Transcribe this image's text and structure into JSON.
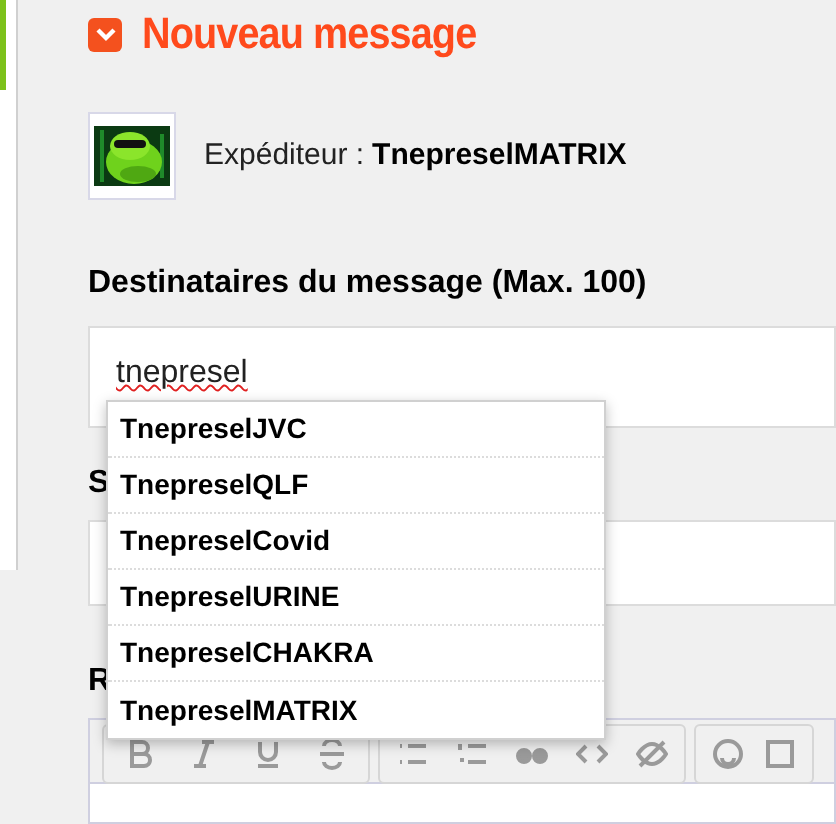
{
  "title": "Nouveau message",
  "sender": {
    "label": "Expéditeur :",
    "name": "TnepreselMATRIX"
  },
  "recipients": {
    "label": "Destinataires du message (Max. 100)",
    "value": "tnepresel"
  },
  "suggestions": [
    {
      "label": "TnepreselJVC"
    },
    {
      "label": "TnepreselQLF"
    },
    {
      "label": "TnepreselCovid"
    },
    {
      "label": "TnepreselURINE"
    },
    {
      "label": "TnepreselCHAKRA"
    },
    {
      "label": "TnepreselMATRIX"
    }
  ],
  "subject": {
    "label": "S"
  },
  "body": {
    "label": "R"
  }
}
